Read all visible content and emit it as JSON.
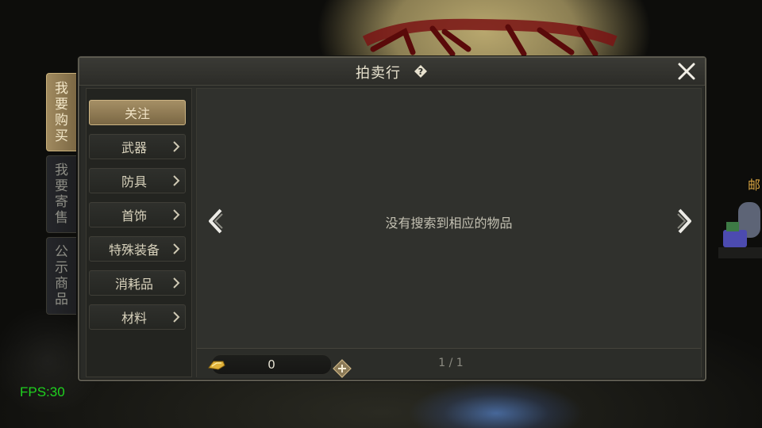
{
  "background": {
    "mail_label": "邮"
  },
  "fps": "FPS:30",
  "side_tabs": [
    {
      "label": [
        "我",
        "要",
        "购",
        "买"
      ],
      "active": true
    },
    {
      "label": [
        "我",
        "要",
        "寄",
        "售"
      ],
      "active": false
    },
    {
      "label": [
        "公",
        "示",
        "商",
        "品"
      ],
      "active": false
    }
  ],
  "window": {
    "title": "拍卖行",
    "help_icon": "help-diamond-icon",
    "close_icon": "close-x-icon"
  },
  "categories": [
    {
      "label": "关注",
      "selected": true,
      "has_arrow": false
    },
    {
      "label": "武器",
      "selected": false,
      "has_arrow": true
    },
    {
      "label": "防具",
      "selected": false,
      "has_arrow": true
    },
    {
      "label": "首饰",
      "selected": false,
      "has_arrow": true
    },
    {
      "label": "特殊装备",
      "selected": false,
      "has_arrow": true
    },
    {
      "label": "消耗品",
      "selected": false,
      "has_arrow": true
    },
    {
      "label": "材料",
      "selected": false,
      "has_arrow": true
    }
  ],
  "content": {
    "empty_message": "没有搜索到相应的物品"
  },
  "footer": {
    "gold_icon": "gold-ingot-icon",
    "gold_value": "0",
    "add_icon": "add-plus-icon",
    "page_info": "1 / 1"
  },
  "colors": {
    "accent_gold": "#a58f65",
    "fps_green": "#1fd21f",
    "panel_bg": "#2a2b27"
  }
}
